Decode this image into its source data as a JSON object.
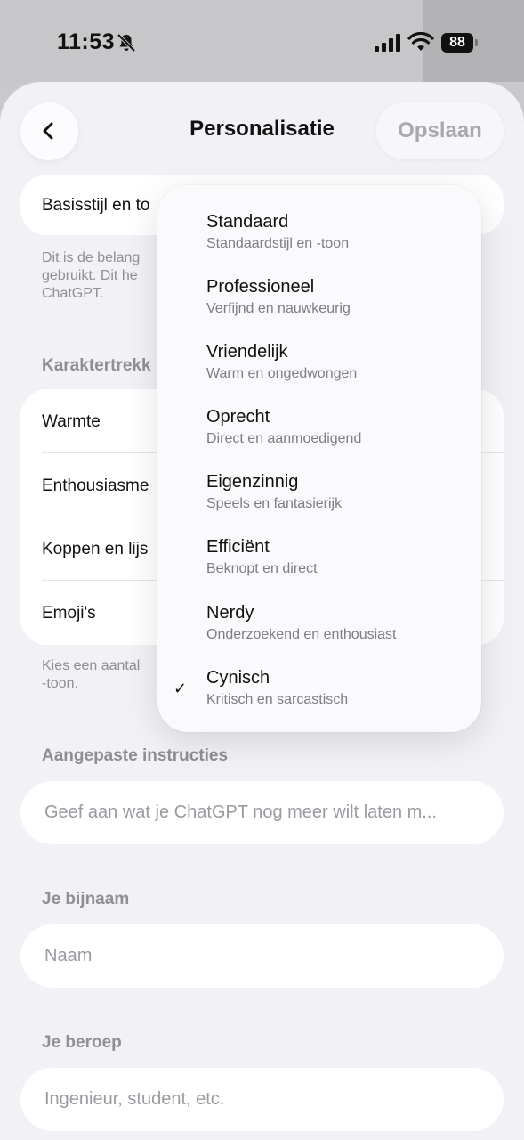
{
  "status_bar": {
    "time": "11:53",
    "battery": "88"
  },
  "header": {
    "title": "Personalisatie",
    "save_label": "Opslaan"
  },
  "base_style": {
    "label": "Basisstijl en to",
    "description_line1": "Dit is de belang",
    "description_line2": "gebruikt. Dit he",
    "description_line3": "ChatGPT."
  },
  "traits": {
    "section_title": "Karaktertrekk",
    "items": [
      "Warmte",
      "Enthousiasme",
      "Koppen en lijs",
      "Emoji's"
    ],
    "footer_line1": "Kies een aantal",
    "footer_line2": "-toon."
  },
  "custom_instructions": {
    "section_title": "Aangepaste instructies",
    "placeholder": "Geef aan wat je ChatGPT nog meer wilt laten m..."
  },
  "nickname": {
    "section_title": "Je bijnaam",
    "placeholder": "Naam"
  },
  "occupation": {
    "section_title": "Je beroep",
    "placeholder": "Ingenieur, student, etc."
  },
  "style_menu": {
    "selected": "Cynisch",
    "check_glyph": "✓",
    "options": [
      {
        "label": "Standaard",
        "sub": "Standaardstijl en -toon"
      },
      {
        "label": "Professioneel",
        "sub": "Verfijnd en nauwkeurig"
      },
      {
        "label": "Vriendelijk",
        "sub": "Warm en ongedwongen"
      },
      {
        "label": "Oprecht",
        "sub": "Direct en aanmoedigend"
      },
      {
        "label": "Eigenzinnig",
        "sub": "Speels en fantasierijk"
      },
      {
        "label": "Efficiënt",
        "sub": "Beknopt en direct"
      },
      {
        "label": "Nerdy",
        "sub": "Onderzoekend en enthousiast"
      },
      {
        "label": "Cynisch",
        "sub": "Kritisch en sarcastisch"
      }
    ]
  }
}
